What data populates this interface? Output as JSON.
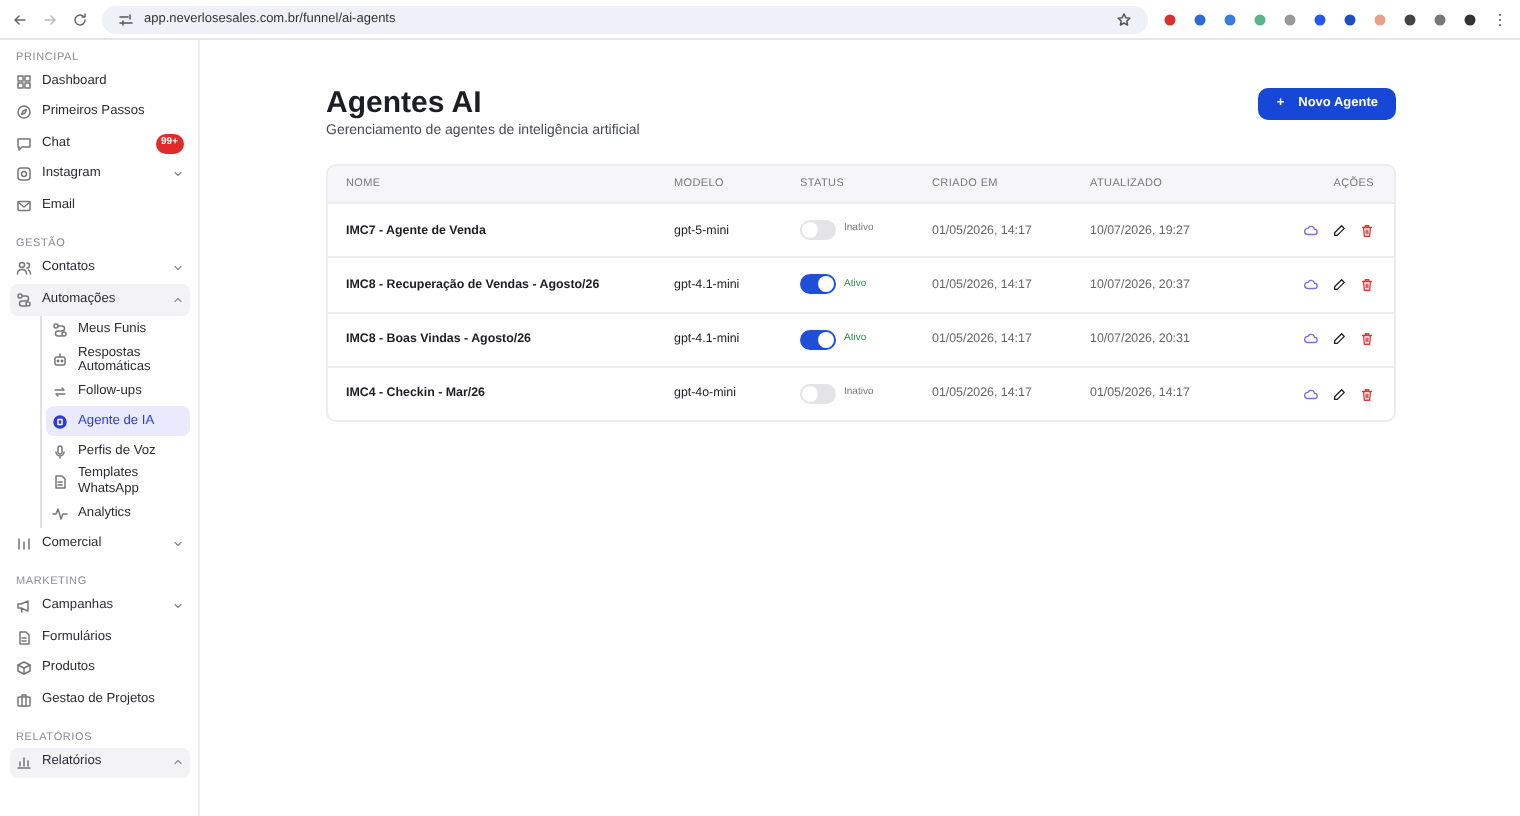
{
  "browser": {
    "url": "app.neverlosesales.com.br/funnel/ai-agents"
  },
  "sidebar": {
    "sections": [
      {
        "title": "PRINCIPAL",
        "items": [
          {
            "label": "Dashboard",
            "selected": false
          },
          {
            "label": "Primeiros Passos",
            "selected": false
          },
          {
            "label": "Chat",
            "selected": false,
            "badge": "99+"
          },
          {
            "label": "Instagram",
            "selected": false,
            "expanded": false
          },
          {
            "label": "Email",
            "selected": false
          }
        ]
      },
      {
        "title": "GESTÃO",
        "items": [
          {
            "label": "Contatos",
            "selected": false,
            "expanded": false
          },
          {
            "label": "Automações",
            "selected": false,
            "expanded": true,
            "children": [
              {
                "label": "Meus Funis",
                "selected": false
              },
              {
                "label": "Respostas Automáticas",
                "selected": false
              },
              {
                "label": "Follow-ups",
                "selected": false
              },
              {
                "label": "Agente de IA",
                "selected": true
              },
              {
                "label": "Perfis de Voz",
                "selected": false
              },
              {
                "label": "Templates WhatsApp",
                "selected": false
              },
              {
                "label": "Analytics",
                "selected": false
              }
            ]
          },
          {
            "label": "Comercial",
            "selected": false,
            "expanded": false
          }
        ]
      },
      {
        "title": "MARKETING",
        "items": [
          {
            "label": "Campanhas",
            "selected": false,
            "expanded": false
          },
          {
            "label": "Formulários",
            "selected": false
          },
          {
            "label": "Produtos",
            "selected": false
          },
          {
            "label": "Gestao de Projetos",
            "selected": false
          }
        ]
      },
      {
        "title": "RELATÓRIOS",
        "items": [
          {
            "label": "Relatórios",
            "selected": false,
            "expanded": true
          }
        ]
      }
    ]
  },
  "page": {
    "title": "Agentes AI",
    "subtitle": "Gerenciamento de agentes de inteligência artificial",
    "new_button": {
      "icon": "+",
      "label": "Novo Agente"
    }
  },
  "table": {
    "columns": [
      "NOME",
      "MODELO",
      "STATUS",
      "CRIADO EM",
      "ATUALIZADO",
      "AÇÕES"
    ],
    "rows": [
      {
        "name": "IMC7 - Agente de Venda",
        "model": "gpt-5-mini",
        "on": false,
        "status": "Inativo",
        "created": "01/05/2026, 14:17",
        "updated": "10/07/2026, 19:27"
      },
      {
        "name": "IMC8 - Recuperação de Vendas - Agosto/26",
        "model": "gpt-4.1-mini",
        "on": true,
        "status": "Ativo",
        "created": "01/05/2026, 14:17",
        "updated": "10/07/2026, 20:37"
      },
      {
        "name": "IMC8 - Boas Vindas - Agosto/26",
        "model": "gpt-4.1-mini",
        "on": true,
        "status": "Ativo",
        "created": "01/05/2026, 14:17",
        "updated": "10/07/2026, 20:31"
      },
      {
        "name": "IMC4 - Checkin - Mar/26",
        "model": "gpt-4o-mini",
        "on": false,
        "status": "Inativo",
        "created": "01/05/2026, 14:17",
        "updated": "01/05/2026, 14:17"
      }
    ]
  }
}
